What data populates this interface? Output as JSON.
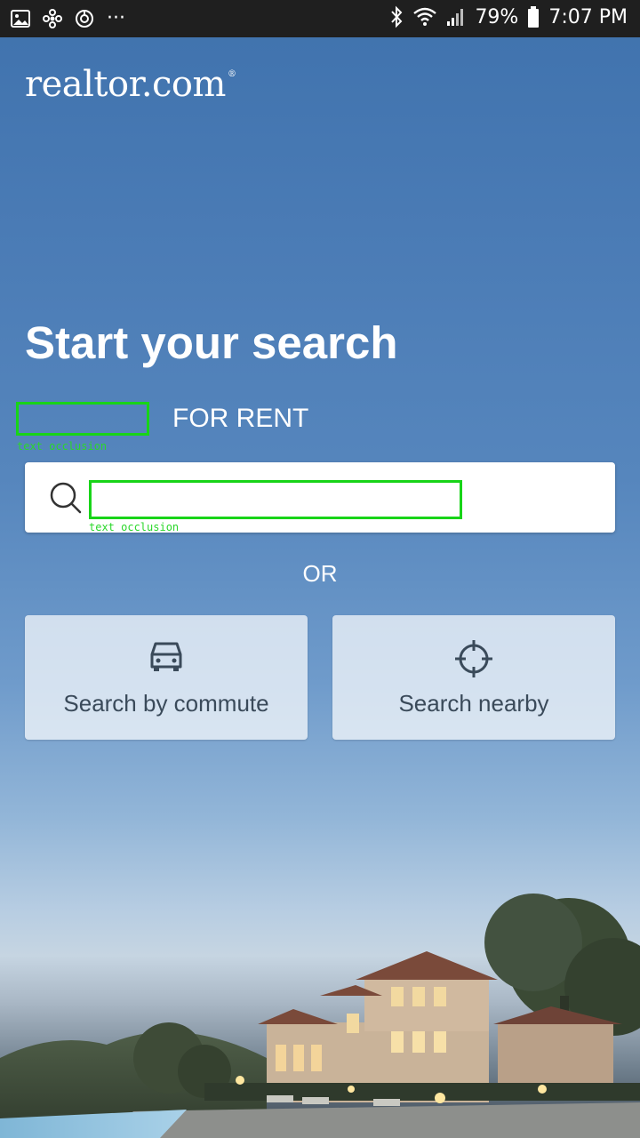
{
  "status_bar": {
    "battery": "79%",
    "time": "7:07 PM",
    "overflow": "···"
  },
  "logo": {
    "text": "realtor.com",
    "mark": "®"
  },
  "search": {
    "heading": "Start your search",
    "tabs": [
      {
        "label": "",
        "occluded": true
      },
      {
        "label": "FOR RENT"
      }
    ],
    "input_placeholder": "",
    "occlusion_note": "text occlusion",
    "or_text": "OR"
  },
  "options": [
    {
      "label": "Search by commute",
      "icon": "car-icon"
    },
    {
      "label": "Search nearby",
      "icon": "crosshair-icon"
    }
  ]
}
